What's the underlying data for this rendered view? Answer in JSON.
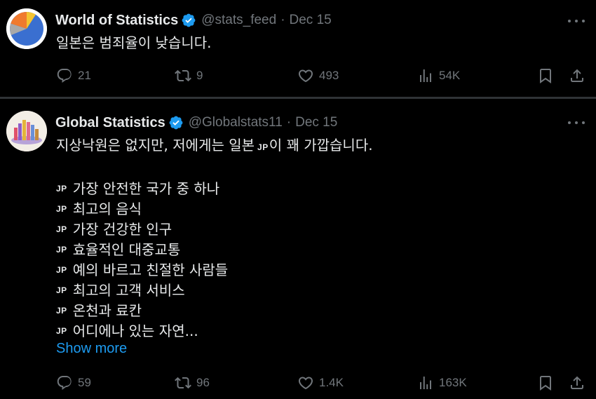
{
  "tweets": [
    {
      "author": {
        "name": "World of Statistics",
        "handle": "@stats_feed",
        "verified": true,
        "avatar": "pie-chart-avatar"
      },
      "separator": "·",
      "date": "Dec 15",
      "text": "일본은 범죄율이 낮습니다.",
      "stats": {
        "replies": "21",
        "retweets": "9",
        "likes": "493",
        "views": "54K"
      }
    },
    {
      "author": {
        "name": "Global Statistics",
        "handle": "@Globalstats11",
        "verified": true,
        "avatar": "bar-chart-avatar"
      },
      "separator": "·",
      "date": "Dec 15",
      "text_before_flag": "지상낙원은 없지만, 저에게는 일본",
      "inline_flag": "JP",
      "text_after_flag": "이 꽤 가깝습니다.",
      "list": [
        {
          "flag": "JP",
          "text": "가장 안전한 국가 중 하나"
        },
        {
          "flag": "JP",
          "text": "최고의 음식"
        },
        {
          "flag": "JP",
          "text": "가장 건강한 인구"
        },
        {
          "flag": "JP",
          "text": "효율적인 대중교통"
        },
        {
          "flag": "JP",
          "text": "예의 바르고 친절한 사람들"
        },
        {
          "flag": "JP",
          "text": "최고의 고객 서비스"
        },
        {
          "flag": "JP",
          "text": "온천과 료칸"
        },
        {
          "flag": "JP",
          "text": "어디에나 있는 자연..."
        }
      ],
      "show_more": "Show more",
      "stats": {
        "replies": "59",
        "retweets": "96",
        "likes": "1.4K",
        "views": "163K"
      }
    }
  ],
  "colors": {
    "background": "#000000",
    "text": "#e7e9ea",
    "muted": "#71767b",
    "accent": "#1d9bf0",
    "divider": "#2f3336"
  },
  "icons": [
    "reply-icon",
    "retweet-icon",
    "like-icon",
    "views-icon",
    "bookmark-icon",
    "share-icon",
    "verified-badge-icon",
    "more-icon"
  ]
}
